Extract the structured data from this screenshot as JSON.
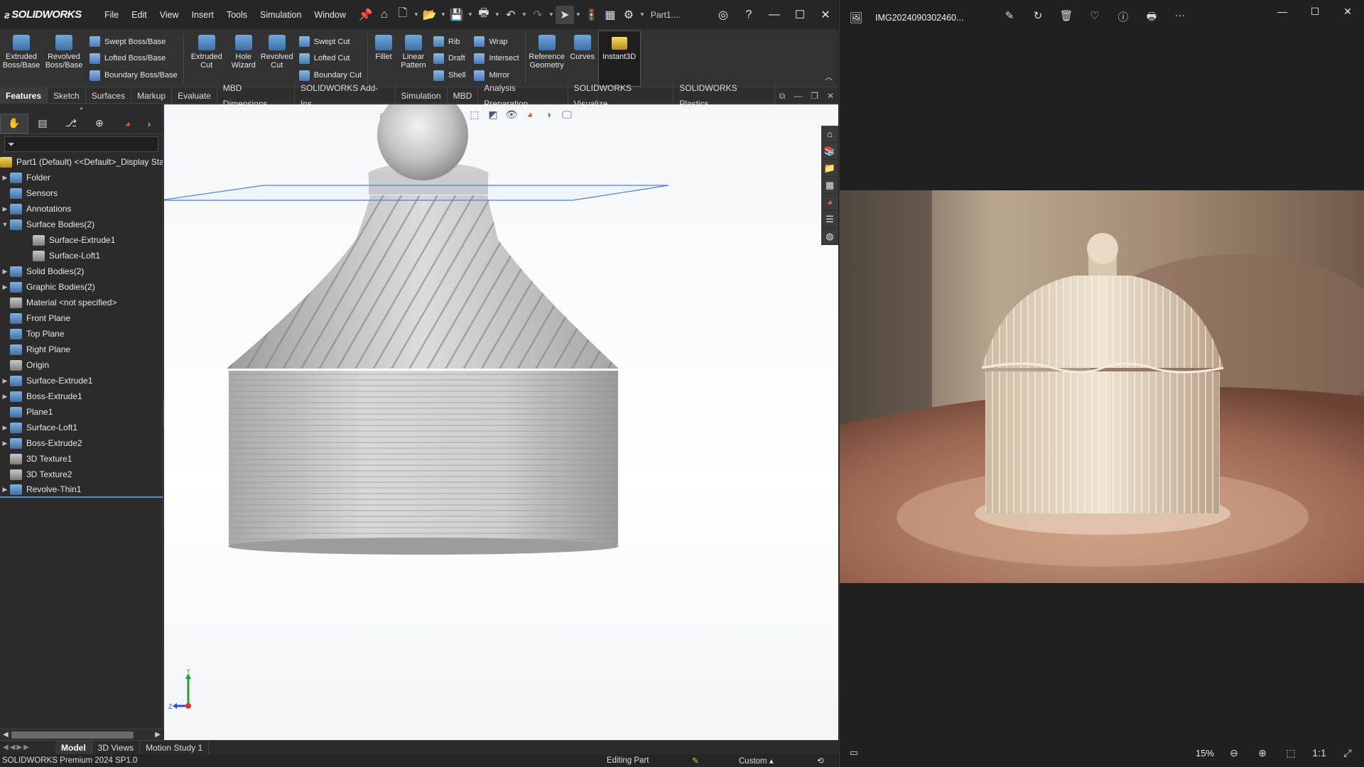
{
  "solidworks": {
    "logo": "SOLIDWORKS",
    "menu": [
      "File",
      "Edit",
      "View",
      "Insert",
      "Tools",
      "Simulation",
      "Window"
    ],
    "doc_title": "Part1....",
    "ribbon": {
      "extruded_boss": "Extruded\nBoss/Base",
      "revolved_boss": "Revolved\nBoss/Base",
      "swept_boss": "Swept Boss/Base",
      "lofted_boss": "Lofted Boss/Base",
      "boundary_boss": "Boundary Boss/Base",
      "extruded_cut": "Extruded\nCut",
      "hole_wizard": "Hole\nWizard",
      "revolved_cut": "Revolved\nCut",
      "swept_cut": "Swept Cut",
      "lofted_cut": "Lofted Cut",
      "boundary_cut": "Boundary Cut",
      "fillet": "Fillet",
      "linear_pattern": "Linear\nPattern",
      "rib": "Rib",
      "draft": "Draft",
      "shell": "Shell",
      "wrap": "Wrap",
      "intersect": "Intersect",
      "mirror": "Mirror",
      "reference_geometry": "Reference\nGeometry",
      "curves": "Curves",
      "instant3d": "Instant3D"
    },
    "tabs": [
      "Features",
      "Sketch",
      "Surfaces",
      "Markup",
      "Evaluate",
      "MBD Dimensions",
      "SOLIDWORKS Add-Ins",
      "Simulation",
      "MBD",
      "Analysis Preparation",
      "SOLIDWORKS Visualize",
      "SOLIDWORKS Plastics"
    ],
    "tree": [
      {
        "label": "Part1 (Default) <<Default>_Display Sta",
        "icon": "part-icon",
        "arrow": ""
      },
      {
        "label": "Folder",
        "icon": "folder-icon",
        "arrow": "▶"
      },
      {
        "label": "Sensors",
        "icon": "sensor-icon",
        "arrow": ""
      },
      {
        "label": "Annotations",
        "icon": "annotation-icon",
        "arrow": "▶"
      },
      {
        "label": "Surface Bodies(2)",
        "icon": "surface-bodies-icon",
        "arrow": "▼"
      },
      {
        "label": "Surface-Extrude1",
        "icon": "surface-icon",
        "arrow": "",
        "child": true
      },
      {
        "label": "Surface-Loft1",
        "icon": "surface-icon",
        "arrow": "",
        "child": true
      },
      {
        "label": "Solid Bodies(2)",
        "icon": "solid-bodies-icon",
        "arrow": "▶"
      },
      {
        "label": "Graphic Bodies(2)",
        "icon": "graphic-bodies-icon",
        "arrow": "▶"
      },
      {
        "label": "Material <not specified>",
        "icon": "material-icon",
        "arrow": ""
      },
      {
        "label": "Front Plane",
        "icon": "plane-icon",
        "arrow": ""
      },
      {
        "label": "Top Plane",
        "icon": "plane-icon",
        "arrow": ""
      },
      {
        "label": "Right Plane",
        "icon": "plane-icon",
        "arrow": ""
      },
      {
        "label": "Origin",
        "icon": "origin-icon",
        "arrow": ""
      },
      {
        "label": "Surface-Extrude1",
        "icon": "surface-extrude-icon",
        "arrow": "▶"
      },
      {
        "label": "Boss-Extrude1",
        "icon": "boss-extrude-icon",
        "arrow": "▶"
      },
      {
        "label": "Plane1",
        "icon": "plane-icon",
        "arrow": ""
      },
      {
        "label": "Surface-Loft1",
        "icon": "surface-loft-icon",
        "arrow": "▶"
      },
      {
        "label": "Boss-Extrude2",
        "icon": "boss-extrude-icon",
        "arrow": "▶"
      },
      {
        "label": "3D Texture1",
        "icon": "texture-icon",
        "arrow": ""
      },
      {
        "label": "3D Texture2",
        "icon": "texture-icon",
        "arrow": ""
      },
      {
        "label": "Revolve-Thin1",
        "icon": "revolve-icon",
        "arrow": "▶"
      }
    ],
    "model_tabs": [
      "Model",
      "3D Views",
      "Motion Study 1"
    ],
    "status": {
      "product": "SOLIDWORKS Premium 2024 SP1.0",
      "mode": "Editing Part",
      "units": "Custom"
    },
    "triad": {
      "y": "Y",
      "z": "Z"
    }
  },
  "photos": {
    "filename": "IMG2024090302460...",
    "zoom": "15%"
  },
  "colors": {
    "selection_blue": "#4a90d9",
    "accent": "#3d6fa6"
  }
}
